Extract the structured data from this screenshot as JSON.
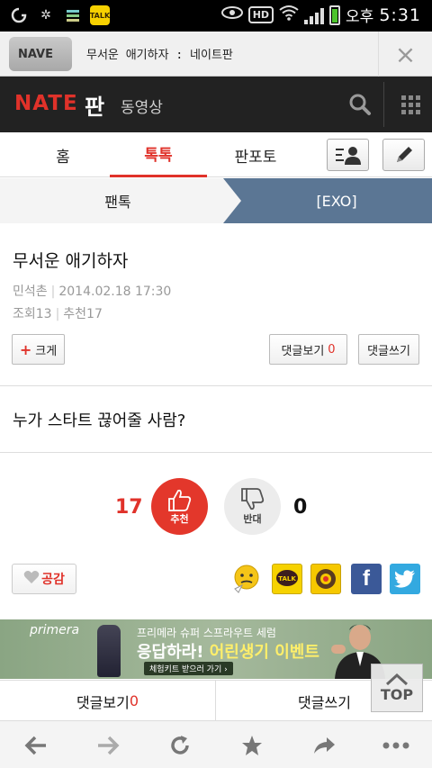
{
  "status_bar": {
    "ampm": "오후",
    "time": "5:31",
    "hd_label": "HD",
    "kakao_label": "TALK"
  },
  "url_bar": {
    "tab_label": "NAVE",
    "page_title": "무서운 애기하자 : 네이트판",
    "close_symbol": "×"
  },
  "header": {
    "logo": "NATE",
    "service": "판",
    "video_link": "동영상"
  },
  "nav": {
    "tabs": [
      "홈",
      "톡톡",
      "판포토"
    ],
    "active_index": 1
  },
  "breadcrumb": {
    "category": "팬톡",
    "board": "[EXO]"
  },
  "article": {
    "title": "무서운 애기하자",
    "author": "민석촌",
    "date": "2014.02.18 17:30",
    "views": "조회13",
    "recommends": "추천17",
    "size_button": "크게",
    "view_comments_label": "댓글보기",
    "comment_count": "0",
    "write_comment_label": "댓글쓰기",
    "body": "누가 스타트 끊어줄 사람?"
  },
  "votes": {
    "up_count": "17",
    "up_label": "추천",
    "down_label": "반대",
    "down_count": "0"
  },
  "share": {
    "empathy_label": "공감",
    "kakao_label": "TALK",
    "facebook_label": "f"
  },
  "ad": {
    "brand": "primera",
    "line1": "프리메라 슈퍼 스프라우트 세럼",
    "line2_a": "응답하라! ",
    "line2_b": "어린생기 이벤트",
    "line3": "체험키트 받으러 가기 ›"
  },
  "bottom": {
    "view_comments_label": "댓글보기",
    "comment_count": "0",
    "write_comment_label": "댓글쓰기",
    "top_label": "TOP"
  },
  "colors": {
    "accent": "#e0322a",
    "header_bg": "#222222",
    "board_bg": "#5b7694",
    "ad_bg": "#9bb091"
  }
}
